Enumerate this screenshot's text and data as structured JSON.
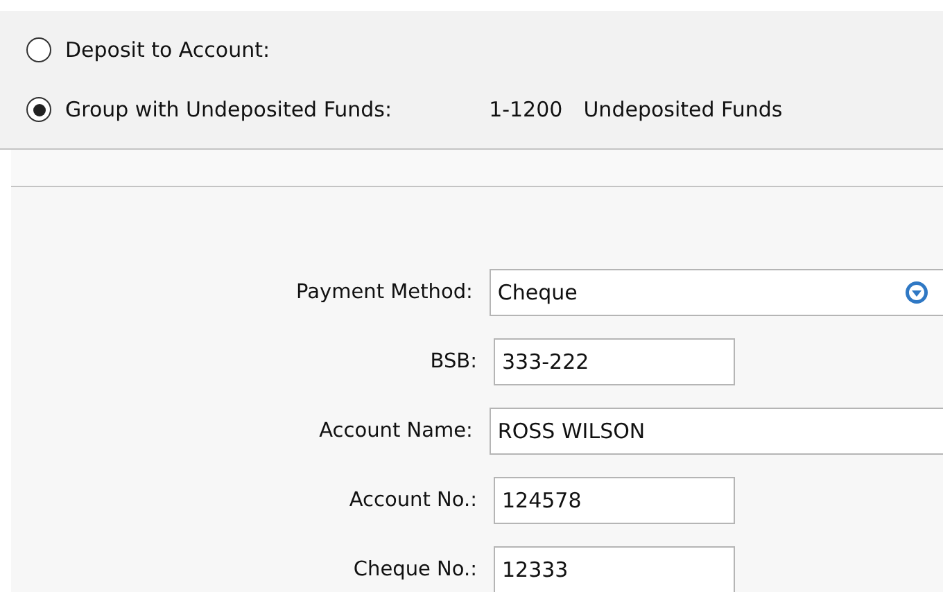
{
  "deposit_options": [
    {
      "label": "Deposit to Account:",
      "selected": false
    },
    {
      "label": "Group with Undeposited Funds:",
      "selected": true,
      "account_number": "1-1200",
      "account_name": "Undeposited Funds"
    }
  ],
  "payment_fields": [
    {
      "kind": "select",
      "label": "Payment Method:",
      "value": "Cheque"
    },
    {
      "kind": "short",
      "label": "BSB:",
      "value": "333-222"
    },
    {
      "kind": "long",
      "label": "Account Name:",
      "value": "ROSS WILSON"
    },
    {
      "kind": "short",
      "label": "Account No.:",
      "value": "124578"
    },
    {
      "kind": "short",
      "label": "Cheque No.:",
      "value": "12333"
    }
  ]
}
